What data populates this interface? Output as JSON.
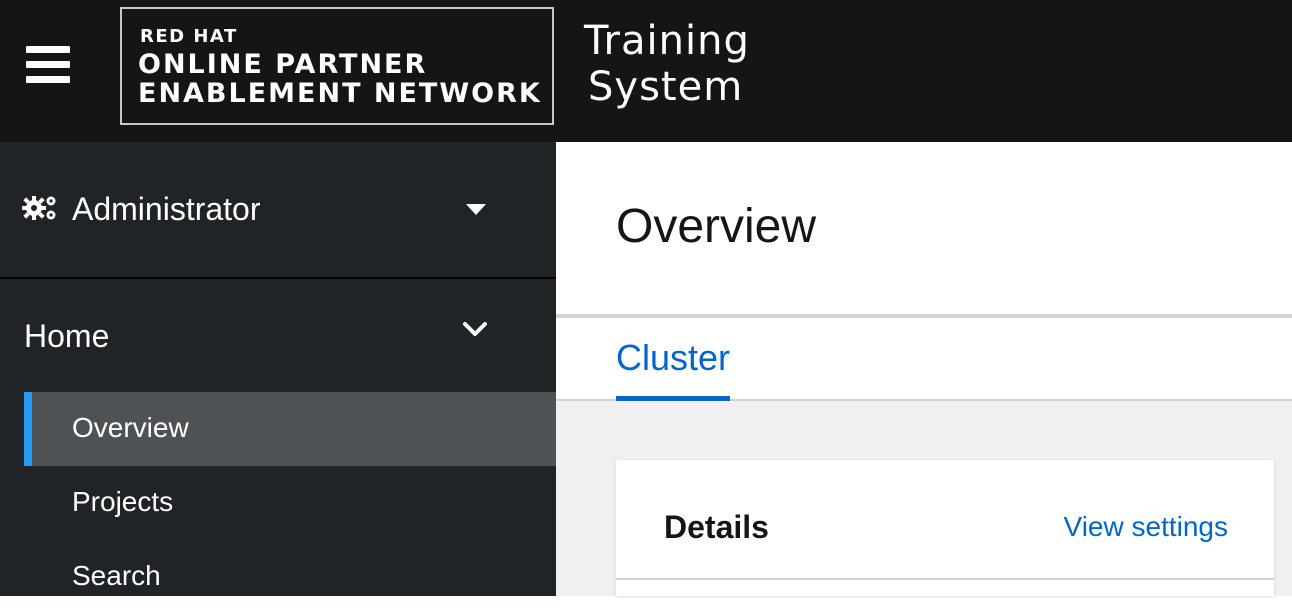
{
  "masthead": {
    "menu_icon": "hamburger-icon",
    "brand": {
      "line1": "RED HAT",
      "line2": "ONLINE PARTNER",
      "line3": "ENABLEMENT NETWORK"
    },
    "system_title_line1": "Training",
    "system_title_line2": "System"
  },
  "sidebar": {
    "perspective": {
      "icon": "cogs-icon",
      "label": "Administrator",
      "caret_icon": "caret-down-icon"
    },
    "section": {
      "label": "Home",
      "chevron_icon": "chevron-down-icon",
      "expanded": true
    },
    "items": [
      {
        "label": "Overview",
        "active": true
      },
      {
        "label": "Projects",
        "active": false
      },
      {
        "label": "Search",
        "active": false
      }
    ]
  },
  "main": {
    "title": "Overview",
    "tabs": [
      {
        "label": "Cluster",
        "active": true
      }
    ],
    "details_card": {
      "title": "Details",
      "link_label": "View settings"
    }
  },
  "colors": {
    "masthead_bg": "#151515",
    "sidebar_bg": "#212427",
    "active_item_bg": "#4f5255",
    "active_indicator": "#2b9af3",
    "link_blue": "#0066cc",
    "content_bg": "#f0f0f0"
  }
}
